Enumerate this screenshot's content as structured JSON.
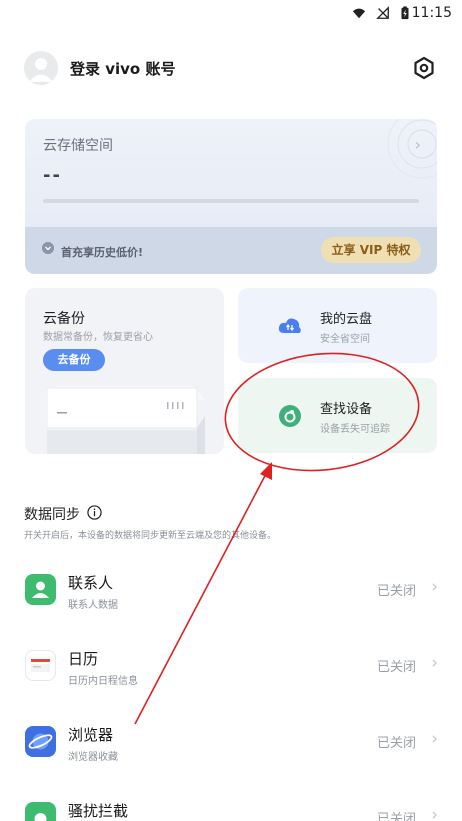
{
  "status_bar": {
    "time": "11:15"
  },
  "header": {
    "login_label": "登录 vivo 账号"
  },
  "cloud_storage": {
    "title": "云存储空间",
    "value": "--",
    "promo": "首充享历史低价!",
    "vip_button": "立享 VIP 特权"
  },
  "backup": {
    "title": "云备份",
    "subtitle": "数据常备份，恢复更省心",
    "button": "去备份"
  },
  "cloud_disk": {
    "title": "我的云盘",
    "subtitle": "安全省空间"
  },
  "find_device": {
    "title": "查找设备",
    "subtitle": "设备丢失可追踪"
  },
  "sync": {
    "title": "数据同步",
    "description": "开关开启后，本设备的数据将同步更新至云端及您的其他设备。",
    "items": [
      {
        "title": "联系人",
        "subtitle": "联系人数据",
        "status": "已关闭",
        "icon": "contacts-icon",
        "color": "#3dbb6f"
      },
      {
        "title": "日历",
        "subtitle": "日历内日程信息",
        "status": "已关闭",
        "icon": "calendar-icon",
        "color": "#e6463c"
      },
      {
        "title": "浏览器",
        "subtitle": "浏览器收藏",
        "status": "已关闭",
        "icon": "browser-icon",
        "color": "#3f6fe0"
      },
      {
        "title": "骚扰拦截",
        "subtitle": "",
        "status": "已关闭",
        "icon": "shield-block-icon",
        "color": "#3dbb6f"
      }
    ]
  },
  "colors": {
    "annotation": "#e02020",
    "accent": "#5a8df0",
    "vip": "#f1dfb4"
  }
}
